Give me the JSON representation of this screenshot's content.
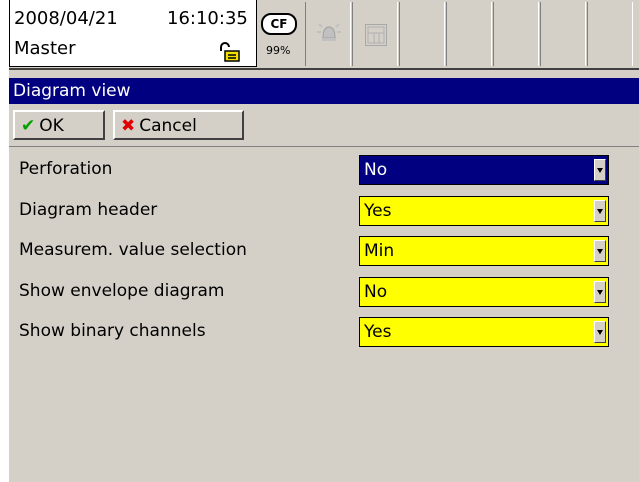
{
  "status": {
    "date": "2008/04/21",
    "time": "16:10:35",
    "user": "Master",
    "cf_label": "CF",
    "cf_usage": "99%"
  },
  "dialog": {
    "title": "Diagram view",
    "ok_label": "OK",
    "cancel_label": "Cancel",
    "settings": [
      {
        "label": "Perforation",
        "value": "No",
        "state": "active"
      },
      {
        "label": "Diagram header",
        "value": "Yes",
        "state": "normal"
      },
      {
        "label": "Measurem. value selection",
        "value": "Min",
        "state": "normal"
      },
      {
        "label": "Show envelope diagram",
        "value": "No",
        "state": "normal"
      },
      {
        "label": "Show binary channels",
        "value": "Yes",
        "state": "normal"
      }
    ]
  },
  "colors": {
    "title_bar": "#000080",
    "active_field": "#000080",
    "field": "#ffff00",
    "ok_glyph": "#00a000",
    "cancel_glyph": "#e00000"
  }
}
